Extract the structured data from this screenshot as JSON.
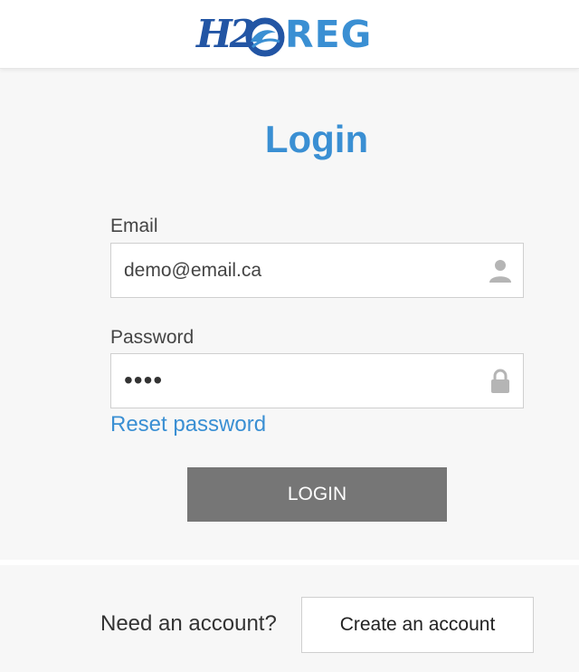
{
  "brand": {
    "logo_name": "H2OREG",
    "logo_prefix": "H2",
    "logo_suffix": "REG",
    "colors": {
      "primary_blue": "#3a8fd3",
      "dark_blue": "#2255a4"
    }
  },
  "login": {
    "title": "Login",
    "email": {
      "label": "Email",
      "value": "demo@email.ca",
      "icon": "user-icon"
    },
    "password": {
      "label": "Password",
      "masked_value": "••••",
      "icon": "lock-icon"
    },
    "reset_link": "Reset password",
    "submit_label": "LOGIN",
    "submit_color": "#767676"
  },
  "footer": {
    "prompt": "Need an account?",
    "create_label": "Create an account"
  }
}
